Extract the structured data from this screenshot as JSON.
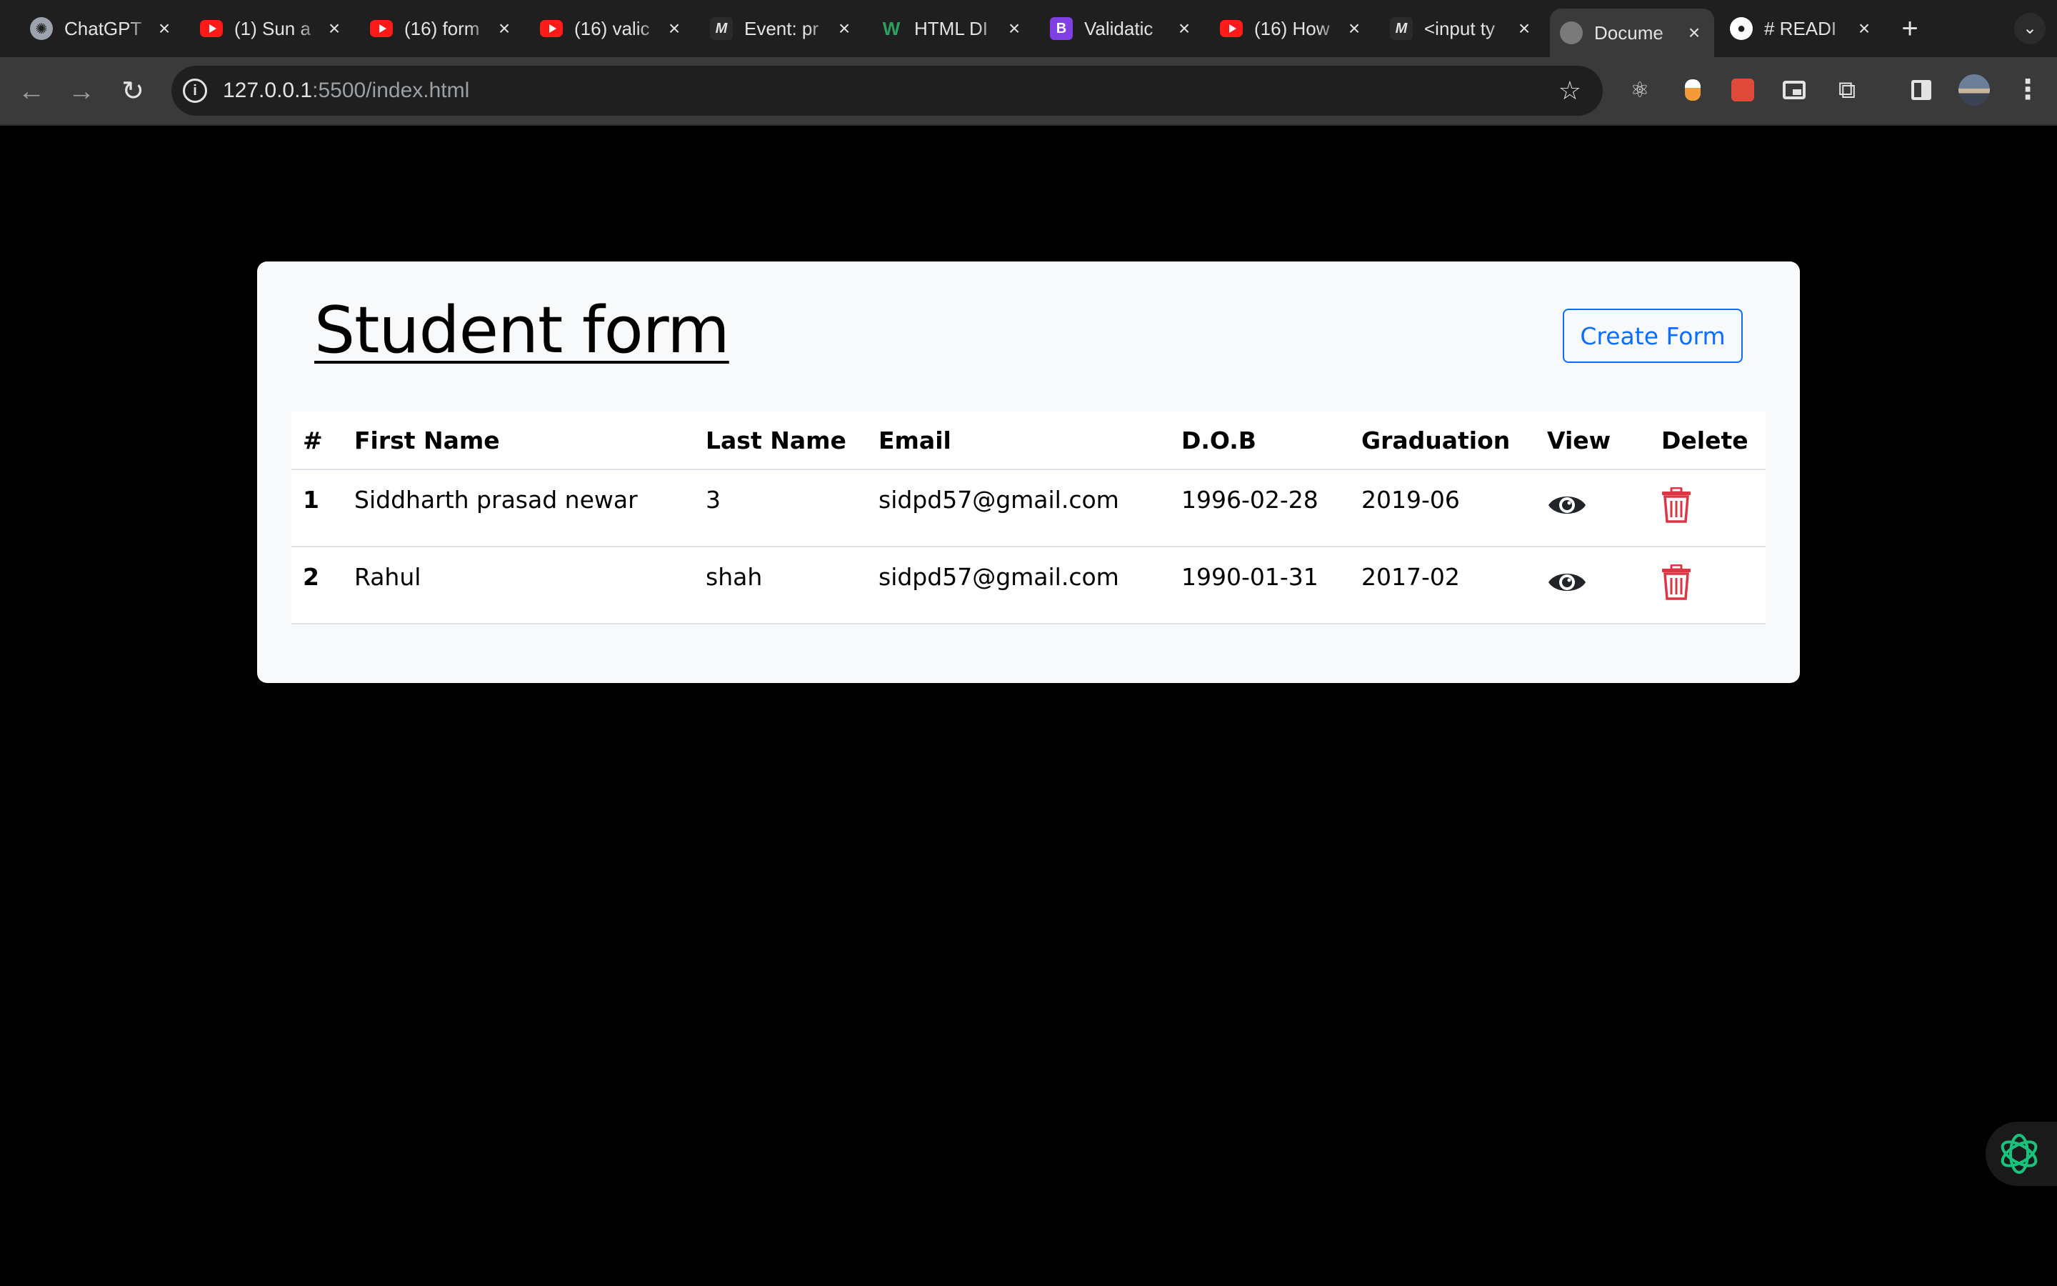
{
  "browser": {
    "tabs": [
      {
        "title": "ChatGPT",
        "favicon": "chatgpt-icon",
        "active": false
      },
      {
        "title": "(1) Sun a",
        "favicon": "youtube-icon",
        "active": false
      },
      {
        "title": "(16) form",
        "favicon": "youtube-icon",
        "active": false
      },
      {
        "title": "(16) valic",
        "favicon": "youtube-icon",
        "active": false
      },
      {
        "title": "Event: pr",
        "favicon": "mdn-icon",
        "active": false
      },
      {
        "title": "HTML DI",
        "favicon": "w3schools-icon",
        "active": false
      },
      {
        "title": "Validatic",
        "favicon": "bootstrap-icon",
        "active": false
      },
      {
        "title": "(16) How",
        "favicon": "youtube-icon",
        "active": false
      },
      {
        "title": "<input ty",
        "favicon": "mdn-icon",
        "active": false
      },
      {
        "title": "Docume",
        "favicon": "globe-icon",
        "active": true
      },
      {
        "title": "# READI",
        "favicon": "github-icon",
        "active": false
      }
    ],
    "url_host": "127.0.0.1",
    "url_path": ":5500/index.html"
  },
  "page": {
    "title": "Student form",
    "create_button": "Create Form"
  },
  "table": {
    "headers": [
      "#",
      "First Name",
      "Last Name",
      "Email",
      "D.O.B",
      "Graduation",
      "View",
      "Delete"
    ],
    "rows": [
      {
        "idx": "1",
        "first": "Siddharth prasad newar",
        "last": "3",
        "email": "sidpd57@gmail.com",
        "dob": "1996-02-28",
        "grad": "2019-06"
      },
      {
        "idx": "2",
        "first": "Rahul",
        "last": "shah",
        "email": "sidpd57@gmail.com",
        "dob": "1990-01-31",
        "grad": "2017-02"
      }
    ]
  },
  "colors": {
    "page_bg": "#000000",
    "card_bg": "#f8f9fa",
    "primary": "#0d6efd",
    "danger": "#dc3545",
    "eye": "#212529"
  }
}
